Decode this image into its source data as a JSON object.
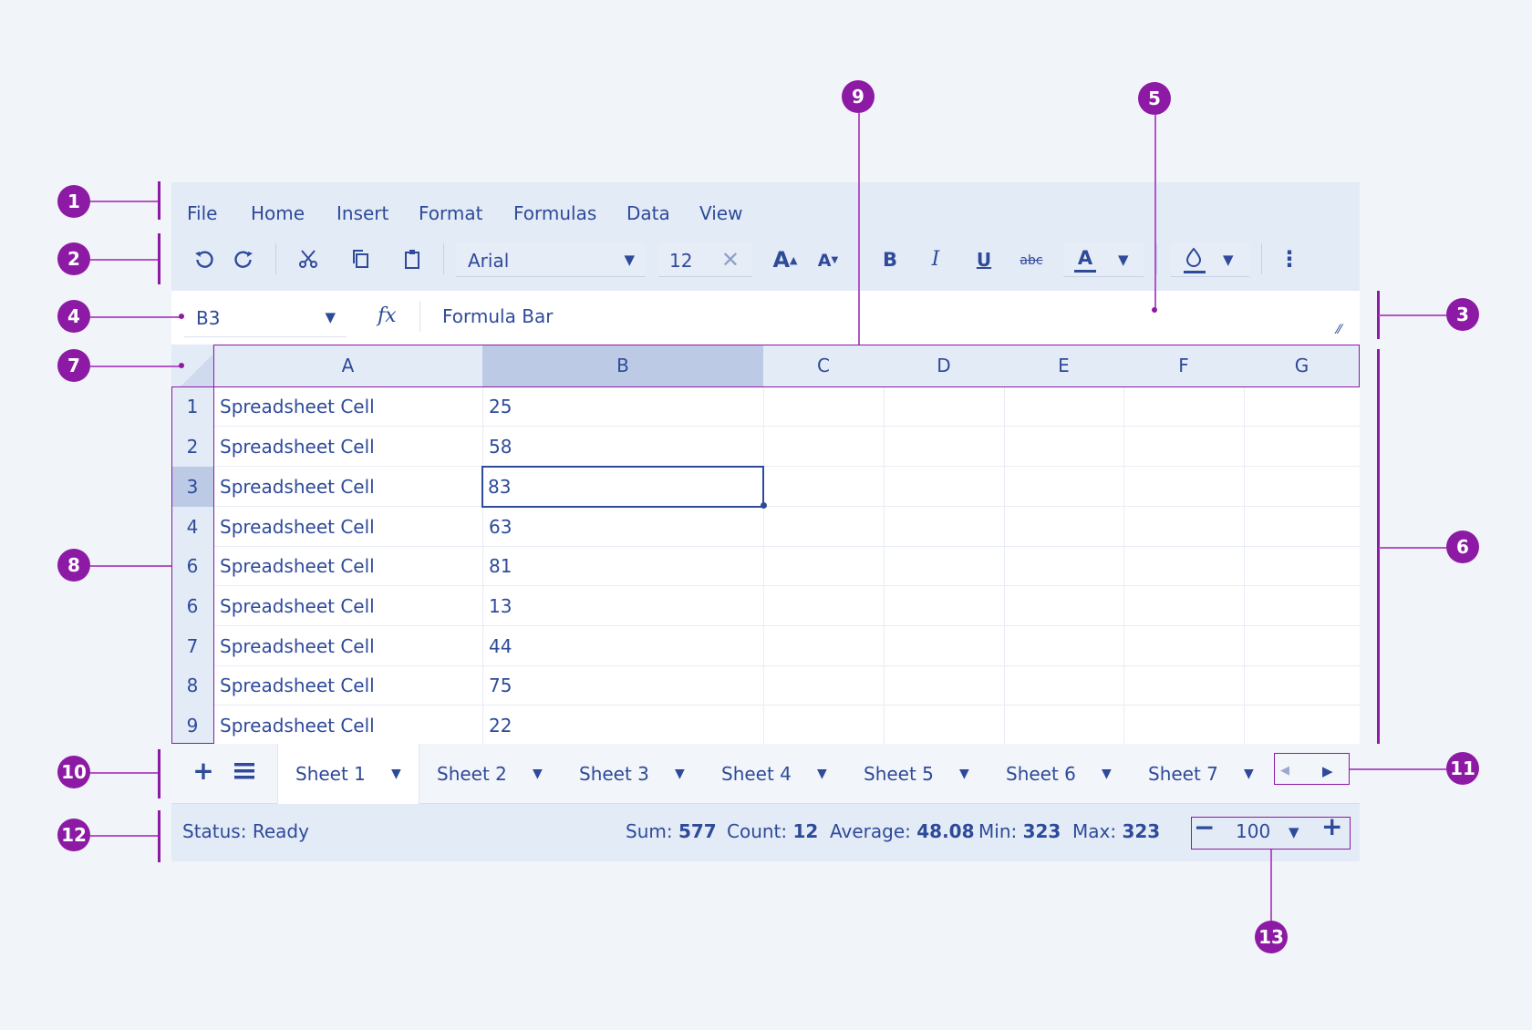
{
  "menu": [
    "File",
    "Home",
    "Insert",
    "Format",
    "Formulas",
    "Data",
    "View"
  ],
  "toolbar": {
    "font_name": "Arial",
    "font_size": "12",
    "icons": [
      "undo-icon",
      "redo-icon",
      "cut-icon",
      "copy-icon",
      "paste-icon",
      "increase-font-icon",
      "decrease-font-icon",
      "bold-icon",
      "italic-icon",
      "underline-icon",
      "strikethrough-icon",
      "text-color-icon",
      "fill-color-icon",
      "more-icon"
    ],
    "bold": "B",
    "italic": "I",
    "underline": "U",
    "strike": "abc",
    "text_color": "A"
  },
  "formula": {
    "cell_ref": "B3",
    "fx": "fx",
    "value": "Formula Bar"
  },
  "columns": [
    "A",
    "B",
    "C",
    "D",
    "E",
    "F",
    "G"
  ],
  "selected_column": "B",
  "rows": [
    {
      "num": "1",
      "a": "Spreadsheet Cell",
      "b": "25"
    },
    {
      "num": "2",
      "a": "Spreadsheet Cell",
      "b": "58"
    },
    {
      "num": "3",
      "a": "Spreadsheet Cell",
      "b": "83"
    },
    {
      "num": "4",
      "a": "Spreadsheet Cell",
      "b": "63"
    },
    {
      "num": "6",
      "a": "Spreadsheet Cell",
      "b": "81"
    },
    {
      "num": "6",
      "a": "Spreadsheet Cell",
      "b": "13"
    },
    {
      "num": "7",
      "a": "Spreadsheet Cell",
      "b": "44"
    },
    {
      "num": "8",
      "a": "Spreadsheet Cell",
      "b": "75"
    },
    {
      "num": "9",
      "a": "Spreadsheet Cell",
      "b": "22"
    }
  ],
  "active_cell": "B3",
  "sheets": [
    "Sheet 1",
    "Sheet 2",
    "Sheet 3",
    "Sheet 4",
    "Sheet 5",
    "Sheet 6",
    "Sheet 7"
  ],
  "active_sheet": "Sheet 1",
  "status": {
    "text": "Status: Ready",
    "sum_label": "Sum:",
    "sum": "577",
    "count_label": "Count:",
    "count": "12",
    "avg_label": "Average:",
    "avg": "48.08",
    "min_label": "Min:",
    "min": "323",
    "max_label": "Max:",
    "max": "323",
    "zoom": "100"
  },
  "callouts": [
    "1",
    "2",
    "3",
    "4",
    "5",
    "6",
    "7",
    "8",
    "9",
    "10",
    "11",
    "12",
    "13"
  ],
  "colors": {
    "accent": "#2e4a9a",
    "annotation": "#8c1aa4",
    "panel": "#e3ebf6",
    "selected_header": "#bccae6"
  }
}
